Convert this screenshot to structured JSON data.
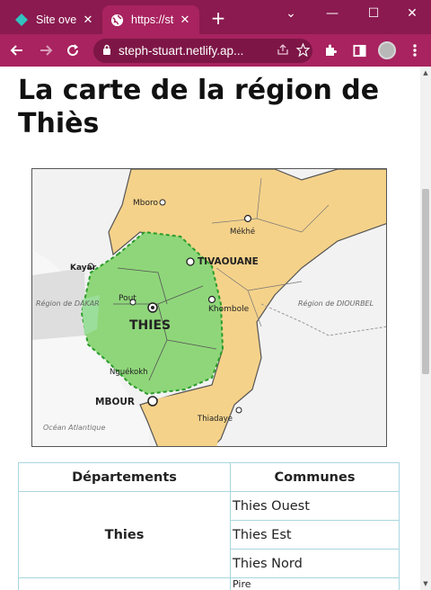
{
  "browser": {
    "tabs": [
      {
        "title": "Site overview",
        "close": "✕",
        "favicon": "netlify-diamond-icon"
      },
      {
        "title": "https://steph-stuart.netlify.app",
        "close": "✕",
        "favicon": "globe-icon"
      }
    ],
    "new_tab": "+",
    "window_controls": {
      "tab_search": "⌄",
      "minimize": "—",
      "maximize": "☐",
      "close": "✕"
    },
    "url": "steph-stuart.netlify.ap...",
    "theme_color": "#a8235f"
  },
  "page": {
    "heading": "La carte de la région de Thiès",
    "map_labels": {
      "mboro": "Mboro",
      "tivaouane": "TIVAOUANE",
      "thies": "THIES",
      "mbour": "MBOUR",
      "kayar": "Kayar",
      "pout": "Pout",
      "khombole": "Khombole",
      "mekhe": "Mékhé",
      "thiadaye": "Thiadaye",
      "region_dakar": "Région de DAKAR",
      "region_diourbel": "Région de DIOURBEL",
      "ocean": "Océan Atlantique",
      "ngueokokh": "Nguékokh"
    },
    "table": {
      "headers": [
        "Départements",
        "Communes"
      ],
      "department": "Thies",
      "communes": [
        "Thies Ouest",
        "Thies Est",
        "Thies Nord",
        "Pire"
      ]
    }
  }
}
